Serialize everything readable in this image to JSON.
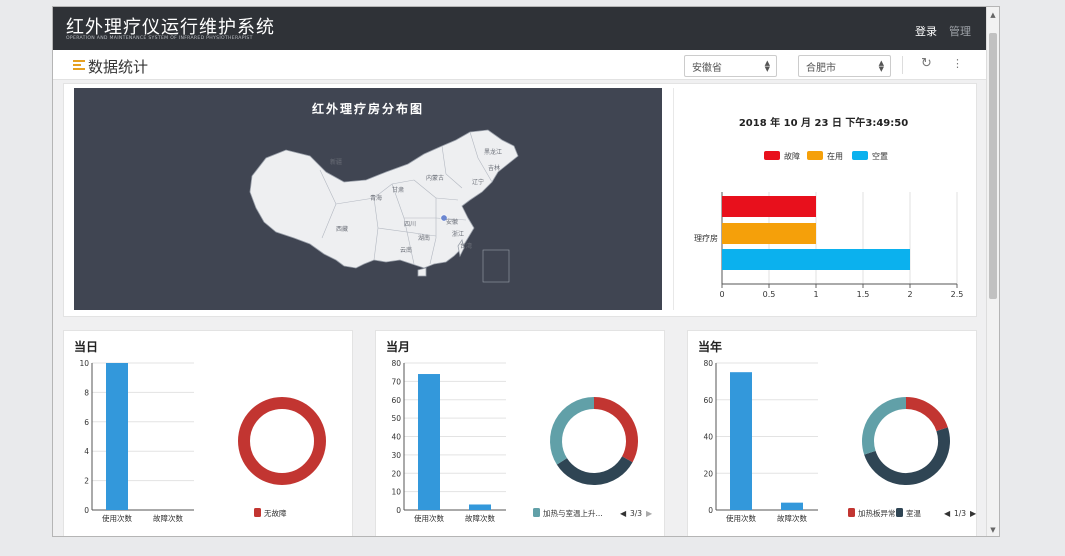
{
  "app": {
    "title": "红外理疗仪运行维护系统",
    "subtitle": "OPERATION AND MAINTENANCE SYSTEM OF INFRARED PHYSIOTHERAPIST",
    "login": "登录",
    "admin": "管理"
  },
  "header": {
    "title": "数据统计",
    "province": "安徽省",
    "city": "合肥市",
    "refresh_icon": "refresh-icon",
    "more_icon": "more-vertical-icon"
  },
  "map": {
    "title": "红外理疗房分布图",
    "region_labels": [
      "新疆",
      "西藏",
      "青海",
      "甘肃",
      "内蒙古",
      "黑龙江",
      "吉林",
      "辽宁",
      "四川",
      "云南",
      "湖南",
      "安徽",
      "浙江",
      "台湾"
    ]
  },
  "status": {
    "timestamp": "2018 年 10 月 23 日 下午3:49:50",
    "chart_data": {
      "type": "bar",
      "orientation": "horizontal",
      "categories": [
        "理疗房"
      ],
      "series": [
        {
          "name": "故障",
          "values": [
            1
          ],
          "color": "#e8101c"
        },
        {
          "name": "在用",
          "values": [
            1
          ],
          "color": "#f5a00a"
        },
        {
          "name": "空置",
          "values": [
            2
          ],
          "color": "#0bb1ee"
        }
      ],
      "xlim": [
        0,
        2.5
      ],
      "xticks": [
        "0",
        "0.5",
        "1",
        "1.5",
        "2",
        "2.5"
      ],
      "legend": "top"
    }
  },
  "cards": [
    {
      "title": "当日",
      "bar_chart": {
        "type": "bar",
        "categories": [
          "使用次数",
          "故障次数"
        ],
        "values": [
          10,
          0
        ],
        "ylim": [
          0,
          10
        ],
        "yticks": [
          "10",
          "8",
          "6",
          "4",
          "2",
          "0"
        ]
      },
      "donut": {
        "type": "pie",
        "slices": [
          {
            "name": "无故障",
            "value": 1,
            "color": "#c23531"
          }
        ],
        "legend": [
          "无故障"
        ]
      }
    },
    {
      "title": "当月",
      "bar_chart": {
        "type": "bar",
        "categories": [
          "使用次数",
          "故障次数"
        ],
        "values": [
          74,
          3
        ],
        "ylim": [
          0,
          80
        ],
        "yticks": [
          "80",
          "70",
          "60",
          "50",
          "40",
          "30",
          "20",
          "10",
          "0"
        ]
      },
      "donut": {
        "type": "pie",
        "slices": [
          {
            "value": 33,
            "color": "#c23531"
          },
          {
            "value": 33,
            "color": "#2f4554"
          },
          {
            "value": 34,
            "color": "#61a0a8"
          }
        ],
        "legend": [
          "加热与室温上升..."
        ],
        "page": "3/3"
      }
    },
    {
      "title": "当年",
      "bar_chart": {
        "type": "bar",
        "categories": [
          "使用次数",
          "故障次数"
        ],
        "values": [
          75,
          4
        ],
        "ylim": [
          0,
          80
        ],
        "yticks": [
          "80",
          "60",
          "40",
          "20",
          "0"
        ]
      },
      "donut": {
        "type": "pie",
        "slices": [
          {
            "value": 20,
            "color": "#c23531"
          },
          {
            "value": 50,
            "color": "#2f4554"
          },
          {
            "value": 30,
            "color": "#61a0a8"
          }
        ],
        "legend": [
          "加热板异常",
          "室温"
        ],
        "page": "1/3"
      }
    }
  ]
}
